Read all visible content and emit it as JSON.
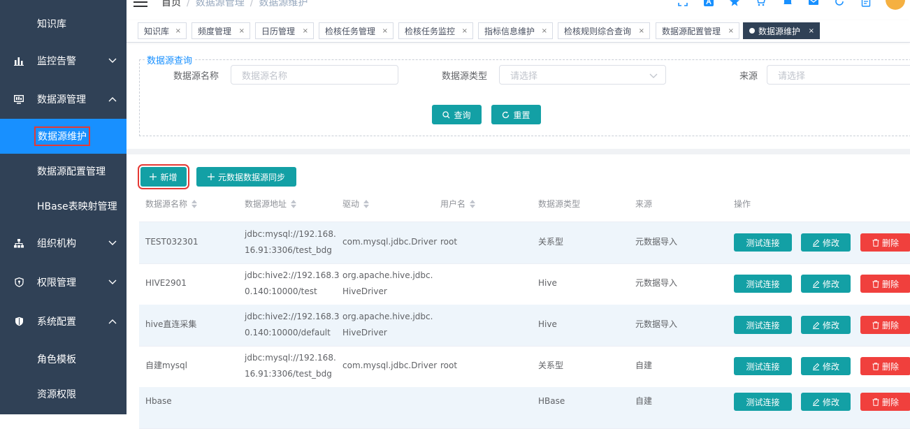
{
  "sidebar": {
    "items": [
      {
        "label": "知识库",
        "icon": "book-icon"
      },
      {
        "label": "监控告警",
        "icon": "bar-chart-icon"
      },
      {
        "label": "数据源管理",
        "icon": "monitor-icon"
      },
      {
        "label": "数据源维护"
      },
      {
        "label": "数据源配置管理"
      },
      {
        "label": "HBase表映射管理"
      },
      {
        "label": "组织机构",
        "icon": "org-tree-icon"
      },
      {
        "label": "权限管理",
        "icon": "shield-icon"
      },
      {
        "label": "系统配置",
        "icon": "shield-check-icon"
      },
      {
        "label": "角色模板"
      },
      {
        "label": "资源权限"
      }
    ]
  },
  "header": {
    "breadcrumb": [
      "首页",
      "数据源管理",
      "数据源维护"
    ]
  },
  "tags": [
    {
      "label": "知识库"
    },
    {
      "label": "频度管理"
    },
    {
      "label": "日历管理"
    },
    {
      "label": "检核任务管理"
    },
    {
      "label": "检核任务监控"
    },
    {
      "label": "指标信息维护"
    },
    {
      "label": "检核规则综合查询"
    },
    {
      "label": "数据源配置管理"
    },
    {
      "label": "数据源维护"
    }
  ],
  "tag_close": "×",
  "query": {
    "legend": "数据源查询",
    "name_label": "数据源名称",
    "name_placeholder": "数据源名称",
    "type_label": "数据源类型",
    "type_placeholder": "请选择",
    "source_label": "来源",
    "source_placeholder": "请选择",
    "search_label": "查询",
    "reset_label": "重置"
  },
  "toolbar": {
    "add_label": "新增",
    "sync_label": "元数据数据源同步"
  },
  "table": {
    "headers": [
      "数据源名称",
      "数据源地址",
      "驱动",
      "用户名",
      "数据源类型",
      "来源",
      "操作"
    ],
    "rows": [
      {
        "name": "TEST032301",
        "addr1": "jdbc:mysql://192.168.",
        "addr2": "16.91:3306/test_bdg",
        "drv1": "com.mysql.jdbc.Driver",
        "drv2": "",
        "user": "root",
        "type": "关系型",
        "source": "元数据导入"
      },
      {
        "name": "HIVE2901",
        "addr1": "jdbc:hive2://192.168.3",
        "addr2": "0.140:10000/test",
        "drv1": "org.apache.hive.jdbc.",
        "drv2": "HiveDriver",
        "user": "",
        "type": "Hive",
        "source": "元数据导入"
      },
      {
        "name": "hive直连采集",
        "addr1": "jdbc:hive2://192.168.3",
        "addr2": "0.140:10000/default",
        "drv1": "org.apache.hive.jdbc.",
        "drv2": "HiveDriver",
        "user": "",
        "type": "Hive",
        "source": "元数据导入"
      },
      {
        "name": "自建mysql",
        "addr1": "jdbc:mysql://192.168.",
        "addr2": "16.91:3306/test_bdg",
        "drv1": "com.mysql.jdbc.Driver",
        "drv2": "",
        "user": "root",
        "type": "关系型",
        "source": "自建"
      },
      {
        "name": "Hbase",
        "addr1": "",
        "addr2": "",
        "drv1": "",
        "drv2": "",
        "user": "",
        "type": "HBase",
        "source": "自建"
      }
    ],
    "actions": {
      "test": "测试连接",
      "edit": "修改",
      "delete": "删除"
    }
  },
  "colors": {
    "sidebar_bg": "#304156",
    "active_blue": "#1890ff",
    "teal": "#13a0a5",
    "danger": "#f0403d",
    "highlight": "#e53935"
  }
}
